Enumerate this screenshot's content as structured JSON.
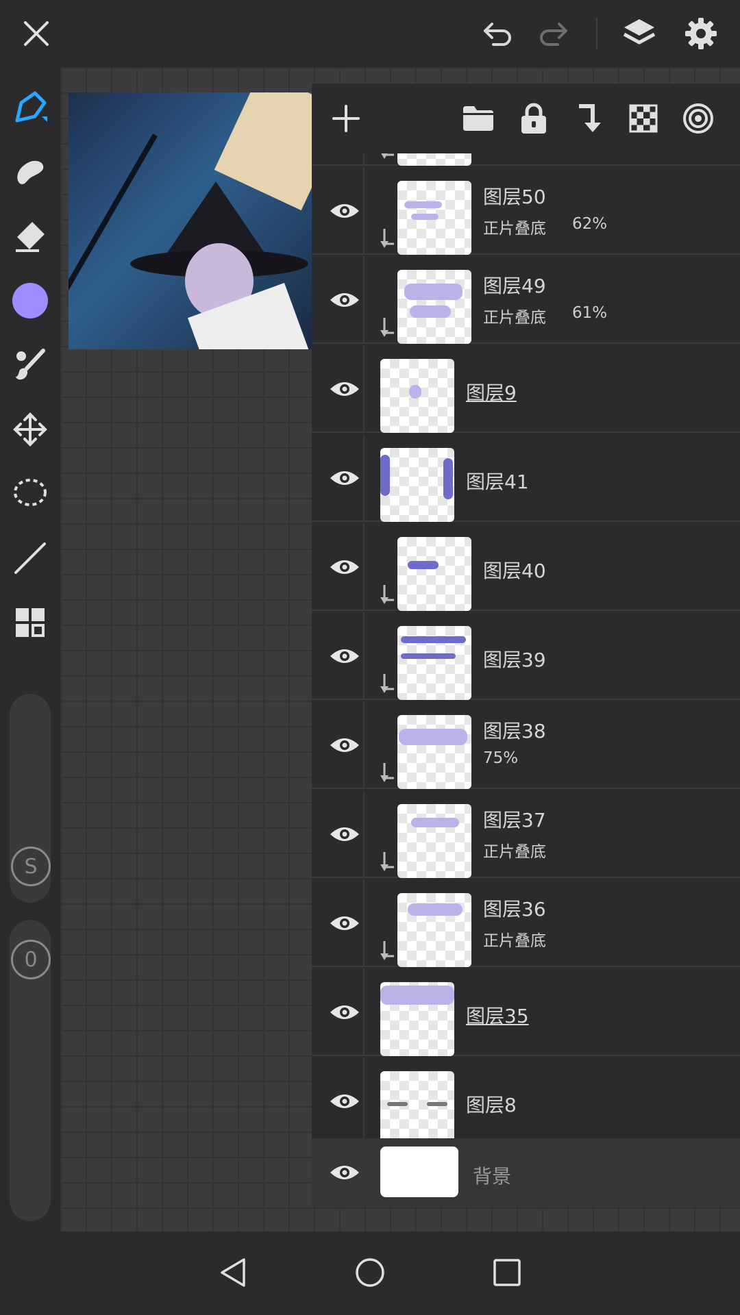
{
  "colors": {
    "accent_brush": "#2aa7ff",
    "current_color": "#a08cff",
    "icon": "#e0e0e0",
    "icon_dim": "#7a7a7a"
  },
  "top_bar": {
    "icons": [
      "close-icon",
      "undo-icon",
      "redo-icon",
      "layers-icon",
      "gear-icon"
    ]
  },
  "left_tools": {
    "icons": [
      "pen-icon",
      "smudge-icon",
      "eraser-icon",
      "color-swatch",
      "brush-tool-icon",
      "transform-icon",
      "lasso-icon",
      "line-icon",
      "materials-icon"
    ],
    "size_slider_label": "S",
    "opacity_slider_label": "0"
  },
  "layers_panel": {
    "toolbar_icons": [
      "add-layer-icon",
      "folder-icon",
      "lock-icon",
      "clip-icon",
      "alpha-lock-icon",
      "layer-effect-icon"
    ],
    "layers": [
      {
        "name": "图层50",
        "blend": "正片叠底",
        "opacity": "62%",
        "clipped": true,
        "underline": false
      },
      {
        "name": "图层49",
        "blend": "正片叠底",
        "opacity": "61%",
        "clipped": true,
        "underline": false
      },
      {
        "name": "图层9",
        "blend": "",
        "opacity": "",
        "clipped": false,
        "underline": true
      },
      {
        "name": "图层41",
        "blend": "",
        "opacity": "",
        "clipped": false,
        "underline": false
      },
      {
        "name": "图层40",
        "blend": "",
        "opacity": "",
        "clipped": true,
        "underline": false
      },
      {
        "name": "图层39",
        "blend": "",
        "opacity": "",
        "clipped": true,
        "underline": false
      },
      {
        "name": "图层38",
        "blend": "",
        "opacity": "75%",
        "clipped": true,
        "underline": false
      },
      {
        "name": "图层37",
        "blend": "正片叠底",
        "opacity": "",
        "clipped": true,
        "underline": false
      },
      {
        "name": "图层36",
        "blend": "正片叠底",
        "opacity": "",
        "clipped": true,
        "underline": false
      },
      {
        "name": "图层35",
        "blend": "",
        "opacity": "",
        "clipped": false,
        "underline": true
      },
      {
        "name": "图层8",
        "blend": "",
        "opacity": "",
        "clipped": false,
        "underline": false
      }
    ],
    "background_layer": {
      "name": "背景"
    }
  },
  "nav_bar": {
    "icons": [
      "back-icon",
      "home-icon",
      "recents-icon"
    ]
  }
}
